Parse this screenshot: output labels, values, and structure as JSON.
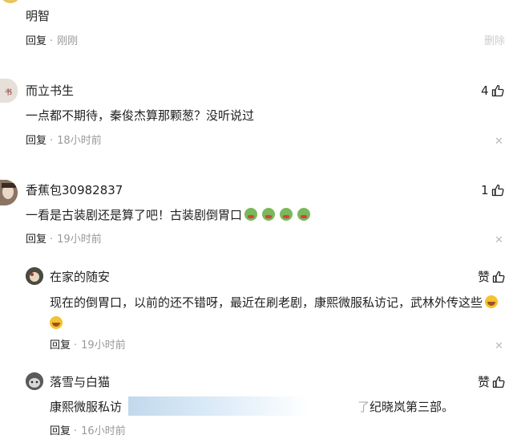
{
  "comments": [
    {
      "text": "明智",
      "reply_label": "回复",
      "time": "刚刚",
      "delete_label": "删除"
    },
    {
      "author": "而立书生",
      "text": "一点都不期待，秦俊杰算那颗葱？没听说过",
      "reply_label": "回复",
      "time": "18小时前",
      "likes": "4"
    },
    {
      "author": "香蕉包30982837",
      "text": "一看是古装剧还是算了吧！古装剧倒胃口",
      "reply_label": "回复",
      "time": "19小时前",
      "likes": "1",
      "emoji_count": 4
    }
  ],
  "replies": [
    {
      "author": "在家的随安",
      "text": "现在的倒胃口，以前的还不错呀，最近在刷老剧，康熙微服私访记，武林外传这些",
      "reply_label": "回复",
      "time": "19小时前",
      "like_label": "赞"
    },
    {
      "author": "落雪与白猫",
      "text_start": "康熙微服私访",
      "text_end": "了纪晓岚第三部。",
      "reply_label": "回复",
      "time": "16小时前",
      "like_label": "赞"
    }
  ],
  "icons": {
    "like": "thumbs-up-icon",
    "close": "close-icon",
    "emoji_green": "nauseated-face-emoji",
    "emoji_laugh": "laughing-face-emoji"
  },
  "colors": {
    "text": "#222222",
    "meta": "#999999",
    "close": "#bbbbbb",
    "delete": "#cccccc"
  }
}
